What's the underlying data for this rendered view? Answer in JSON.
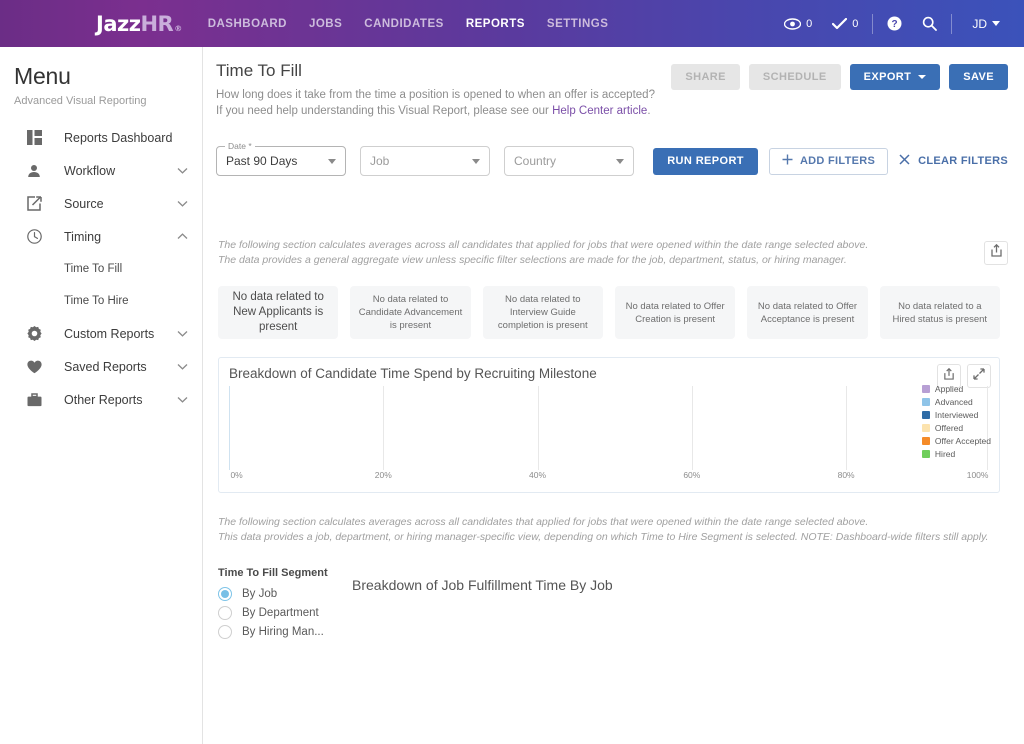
{
  "topnav": {
    "brand_primary": "Jazz",
    "brand_secondary": "HR",
    "brand_tm": "®",
    "links": [
      {
        "label": "DASHBOARD",
        "active": false
      },
      {
        "label": "JOBS",
        "active": false
      },
      {
        "label": "CANDIDATES",
        "active": false
      },
      {
        "label": "REPORTS",
        "active": true
      },
      {
        "label": "SETTINGS",
        "active": false
      }
    ],
    "eye_count": "0",
    "check_count": "0",
    "help_icon": "question-circle-icon",
    "search_icon": "search-icon",
    "avatar_initials": "JD"
  },
  "sidebar": {
    "title": "Menu",
    "subtitle": "Advanced Visual Reporting",
    "items": [
      {
        "label": "Reports Dashboard",
        "icon": "dashboard-grid-icon",
        "chevron": ""
      },
      {
        "label": "Workflow",
        "icon": "person-icon",
        "chevron": "down"
      },
      {
        "label": "Source",
        "icon": "external-link-icon",
        "chevron": "down"
      },
      {
        "label": "Timing",
        "icon": "clock-icon",
        "chevron": "up"
      },
      {
        "label": "Custom Reports",
        "icon": "gear-icon",
        "chevron": "down"
      },
      {
        "label": "Saved Reports",
        "icon": "heart-icon",
        "chevron": "down"
      },
      {
        "label": "Other Reports",
        "icon": "briefcase-icon",
        "chevron": "down"
      }
    ],
    "timing_children": [
      {
        "label": "Time To Fill"
      },
      {
        "label": "Time To Hire"
      }
    ]
  },
  "page": {
    "title": "Time To Fill",
    "desc_line1": "How long does it take from the time a position is opened to when an offer is accepted?",
    "desc_line2_pre": "If you need help understanding this Visual Report, please see our ",
    "desc_link": "Help Center article",
    "desc_line2_post": "."
  },
  "head_actions": {
    "share": "SHARE",
    "schedule": "SCHEDULE",
    "export": "EXPORT",
    "save": "SAVE"
  },
  "filters": {
    "date_legend": "Date *",
    "date_value": "Past 90 Days",
    "job_placeholder": "Job",
    "country_placeholder": "Country",
    "run_report": "RUN REPORT",
    "add_filters": "ADD FILTERS",
    "clear_filters": "CLEAR FILTERS",
    "add_icon": "plus-icon",
    "clear_icon": "close-x-icon"
  },
  "export_tile": {
    "icon": "share-upload-icon"
  },
  "notes_top": {
    "line1": "The following section calculates averages across all candidates that applied for jobs that were opened within the date range selected above.",
    "line2": "The data provides a general aggregate view unless specific filter selections are made for the job, department, status, or hiring manager."
  },
  "stat_cards": [
    {
      "text": "No data related to New Applicants is present",
      "lead": true
    },
    {
      "text": "No data related to Candidate Advancement is present",
      "lead": false
    },
    {
      "text": "No data related to Interview Guide completion is present",
      "lead": false
    },
    {
      "text": "No data related to Offer Creation is present",
      "lead": false
    },
    {
      "text": "No data related to Offer Acceptance is present",
      "lead": false
    },
    {
      "text": "No data related to a Hired status is present",
      "lead": false
    }
  ],
  "notes_bottom": {
    "line1": "The following section calculates averages across all candidates that applied for jobs that were opened within the date range selected above.",
    "line2": "This data provides a job, department, or hiring manager-specific view, depending on which Time to Hire Segment is selected. NOTE: Dashboard-wide filters still apply."
  },
  "segment": {
    "title": "Time To Fill Segment",
    "options": [
      {
        "label": "By Job",
        "selected": true
      },
      {
        "label": "By Department",
        "selected": false
      },
      {
        "label": "By Hiring Man...",
        "selected": false
      }
    ],
    "chart_title": "Breakdown of Job Fulfillment Time By Job"
  },
  "chart_tools": {
    "share_icon": "share-upload-icon",
    "expand_icon": "expand-arrows-icon"
  },
  "chart_data": {
    "type": "bar",
    "orientation": "horizontal",
    "title": "Breakdown of Candidate Time Spend by Recruiting Milestone",
    "xlabel": "",
    "ylabel": "",
    "xlim": [
      0,
      100
    ],
    "xticks": [
      0,
      20,
      40,
      60,
      80,
      100
    ],
    "xtick_labels": [
      "0%",
      "20%",
      "40%",
      "60%",
      "80%",
      "100%"
    ],
    "grid": true,
    "legend_position": "right",
    "categories": [],
    "series": [
      {
        "name": "Applied",
        "color": "#b79fd4",
        "values": []
      },
      {
        "name": "Advanced",
        "color": "#8fc4e8",
        "values": []
      },
      {
        "name": "Interviewed",
        "color": "#2f6ca6",
        "values": []
      },
      {
        "name": "Offered",
        "color": "#fce3ae",
        "values": []
      },
      {
        "name": "Offer Accepted",
        "color": "#f58b28",
        "values": []
      },
      {
        "name": "Hired",
        "color": "#6fce5b",
        "values": []
      }
    ],
    "note": "No data plotted — empty plot area with vertical gridlines only"
  }
}
